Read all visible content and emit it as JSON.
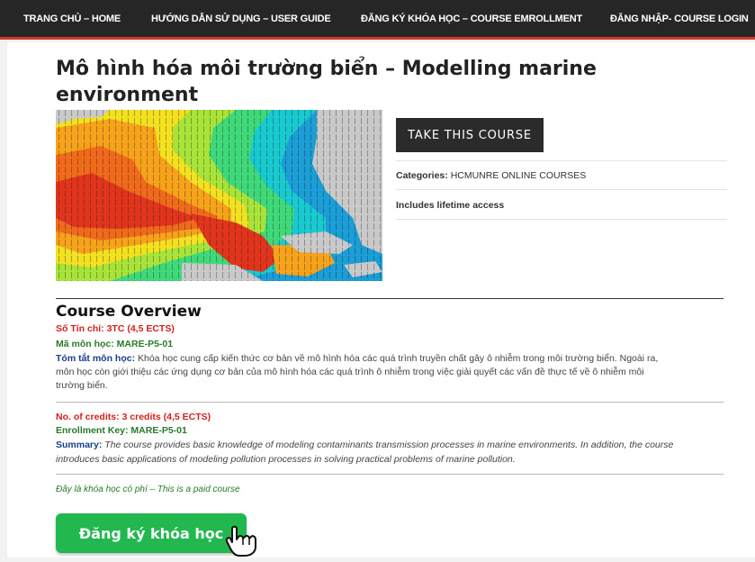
{
  "nav": {
    "home": "TRANG CHỦ – HOME",
    "guide": "HƯỚNG DẪN SỬ DỤNG – USER GUIDE",
    "enroll": "ĐĂNG KÝ KHÓA HỌC – COURSE EMROLLMENT",
    "login": "ĐĂNG NHẬP- COURSE LOGIN"
  },
  "course": {
    "title": "Mô hình hóa môi trường biển – Modelling marine environment",
    "take_button": "TAKE THIS COURSE",
    "categories_label": "Categories:",
    "categories_value": "HCMUNRE ONLINE COURSES",
    "lifetime": "Includes lifetime access"
  },
  "overview": {
    "heading": "Course Overview",
    "credits_vi": "Số Tín chỉ: 3TC (4,5 ECTS)",
    "code_vi": "Mã môn học: MARE-P5-01",
    "summary_vi_label": "Tóm tắt môn học:",
    "summary_vi_l1": "Khóa học cung cấp kiến thức cơ bản về mô hình hóa các quá trình truyền chất gây ô nhiễm trong môi trường biển. Ngoài ra,",
    "summary_vi_l2": "môn học còn giới thiệu các ứng dụng cơ bản của mô hình hóa các quá trình ô nhiễm trong việc giải quyết các vấn đề thực tế về ô nhiễm môi",
    "summary_vi_l3": "trường biển.",
    "credits_en": "No. of credits: 3 credits (4,5 ECTS)",
    "key_en": "Enrollment Key: MARE-P5-01",
    "summary_en_label": "Summary:",
    "summary_en_l1": "The course provides basic knowledge of modeling contaminants transmission processes in marine environments. In addition, the course",
    "summary_en_l2": "introduces basic applications of modeling pollution processes in solving practical problems of marine pollution.",
    "paid_note": "Đây là khóa học có phí – This is a paid course",
    "enroll_button": "Đăng ký khóa học"
  },
  "icons": {
    "hero": "ocean-model-map-image",
    "cursor": "hand-pointer-icon"
  },
  "colors": {
    "nav_bg": "#262626",
    "nav_accent": "#d9362b",
    "red": "#d6201c",
    "green": "#2a7a2a",
    "blue": "#1a3e8f",
    "enroll": "#22b84f"
  }
}
